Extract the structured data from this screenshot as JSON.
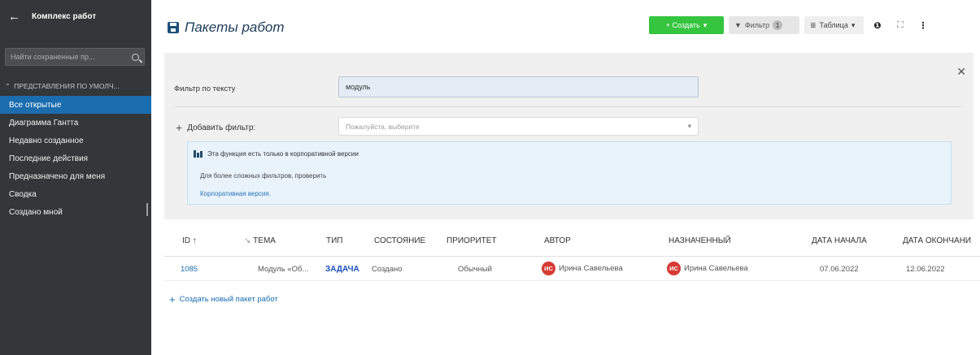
{
  "sidebar": {
    "back_icon": "arrow-left-icon",
    "title": "Комплекс работ",
    "search_placeholder": "Найти сохраненные пр...",
    "section_label": "ПРЕДСТАВЛЕНИЯ ПО УМОЛЧ...",
    "items": [
      {
        "label": "Все открытые",
        "active": true
      },
      {
        "label": "Диаграмма Гантта"
      },
      {
        "label": "Недавно созданное"
      },
      {
        "label": "Последние действия"
      },
      {
        "label": "Предназначено для меня"
      },
      {
        "label": "Сводка"
      },
      {
        "label": "Создано мной"
      }
    ]
  },
  "header": {
    "title": "Пакеты работ",
    "create_label": "+ Создать",
    "filter_label": "Фильтр",
    "filter_count": "1",
    "table_label": "Таблица"
  },
  "filter_panel": {
    "text_filter_label": "Фильтр по тексту",
    "text_filter_value": "модуль",
    "add_filter_label": "Добавить фильтр:",
    "add_filter_placeholder": "Пожалуйста, выберите",
    "enterprise_title": "Эта функция есть только в корпоративной версии",
    "enterprise_text": "Для более сложных фильтров, проверить",
    "enterprise_link": "Корпоративная версия."
  },
  "table": {
    "columns": [
      "ID",
      "ТЕМА",
      "ТИП",
      "СОСТОЯНИЕ",
      "ПРИОРИТЕТ",
      "АВТОР",
      "НАЗНАЧЕННЫЙ",
      "ДАТА НАЧАЛА",
      "ДАТА ОКОНЧАНИ"
    ],
    "rows": [
      {
        "id": "1085",
        "subject": "Модуль «Об...",
        "type": "ЗАДАЧА",
        "status": "Создано",
        "priority": "Обычный",
        "author_initials": "ИС",
        "author": "Ирина Савельева",
        "assignee_initials": "ИС",
        "assignee": "Ирина Савельева",
        "start_date": "07.06.2022",
        "end_date": "12.06.2022"
      }
    ],
    "new_package_label": "Создать новый пакет работ"
  },
  "colors": {
    "sidebar_bg": "#333739",
    "active_item": "#1a6daf",
    "create_button": "#35c53f",
    "avatar": "#d73a34"
  }
}
